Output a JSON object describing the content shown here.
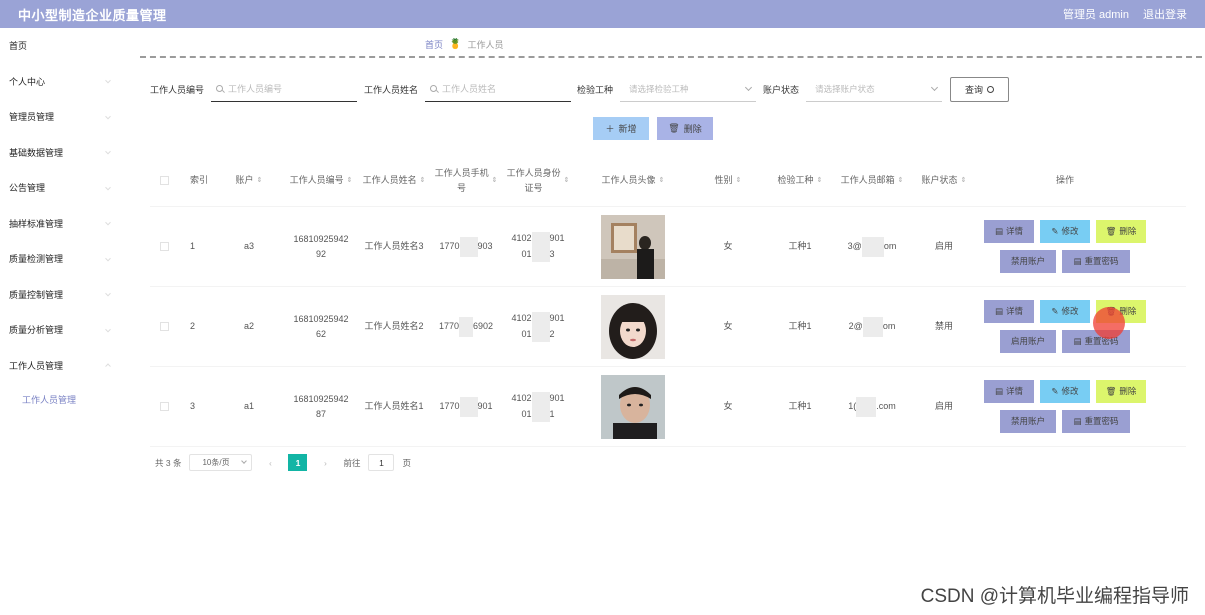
{
  "header": {
    "title": "中小型制造企业质量管理",
    "admin": "管理员 admin",
    "logout": "退出登录"
  },
  "sidebar": {
    "items": [
      {
        "label": "首页"
      },
      {
        "label": "个人中心"
      },
      {
        "label": "管理员管理"
      },
      {
        "label": "基础数据管理"
      },
      {
        "label": "公告管理"
      },
      {
        "label": "抽样标准管理"
      },
      {
        "label": "质量检测管理"
      },
      {
        "label": "质量控制管理"
      },
      {
        "label": "质量分析管理"
      },
      {
        "label": "工作人员管理"
      }
    ],
    "subitem": "工作人员管理"
  },
  "breadcrumb": {
    "home": "首页",
    "current": "工作人员"
  },
  "search": {
    "id_label": "工作人员编号",
    "id_placeholder": "工作人员编号",
    "name_label": "工作人员姓名",
    "name_placeholder": "工作人员姓名",
    "type_label": "检验工种",
    "type_placeholder": "请选择检验工种",
    "status_label": "账户状态",
    "status_placeholder": "请选择账户状态",
    "query_label": "查询"
  },
  "actions": {
    "add": "新增",
    "delete": "删除"
  },
  "table": {
    "headers": [
      "索引",
      "账户",
      "工作人员编号",
      "工作人员姓名",
      "工作人员手机号",
      "工作人员身份证号",
      "工作人员头像",
      "性别",
      "检验工种",
      "工作人员邮箱",
      "账户状态",
      "操作"
    ],
    "rows": [
      {
        "index": "1",
        "account": "a3",
        "id_line1": "16810925942",
        "id_line2": "92",
        "name": "工作人员姓名3",
        "phone_a": "1770",
        "phone_b": "903",
        "idcard_a": "4102",
        "idcard_b": "901",
        "idcard_c": "01",
        "idcard_d": "3",
        "gender": "女",
        "type": "工种1",
        "email_a": "3@",
        "email_b": "om",
        "status": "启用",
        "toggle": "禁用账户"
      },
      {
        "index": "2",
        "account": "a2",
        "id_line1": "16810925942",
        "id_line2": "62",
        "name": "工作人员姓名2",
        "phone_a": "1770",
        "phone_b": "6902",
        "idcard_a": "4102",
        "idcard_b": "901",
        "idcard_c": "01",
        "idcard_d": "2",
        "gender": "女",
        "type": "工种1",
        "email_a": "2@",
        "email_b": "om",
        "status": "禁用",
        "toggle": "启用账户"
      },
      {
        "index": "3",
        "account": "a1",
        "id_line1": "16810925942",
        "id_line2": "87",
        "name": "工作人员姓名1",
        "phone_a": "1770",
        "phone_b": "901",
        "idcard_a": "4102",
        "idcard_b": "901",
        "idcard_c": "01",
        "idcard_d": "1",
        "gender": "女",
        "type": "工种1",
        "email_a": "1(",
        "email_b": ".com",
        "status": "启用",
        "toggle": "禁用账户"
      }
    ],
    "ops": {
      "detail": "详情",
      "edit": "修改",
      "delete": "删除",
      "reset": "重置密码"
    }
  },
  "pagination": {
    "total": "共 3 条",
    "page_size": "10条/页",
    "current": "1",
    "goto": "前往",
    "goto_value": "1",
    "page_unit": "页"
  },
  "watermark": "CSDN @计算机毕业编程指导师",
  "colors": {
    "header": "#9aa3d6",
    "accent": "#7a82c4",
    "detail": "#9a9fd2",
    "edit": "#78cdf3",
    "delete": "#dcf56c",
    "pager": "#12b5a5"
  }
}
